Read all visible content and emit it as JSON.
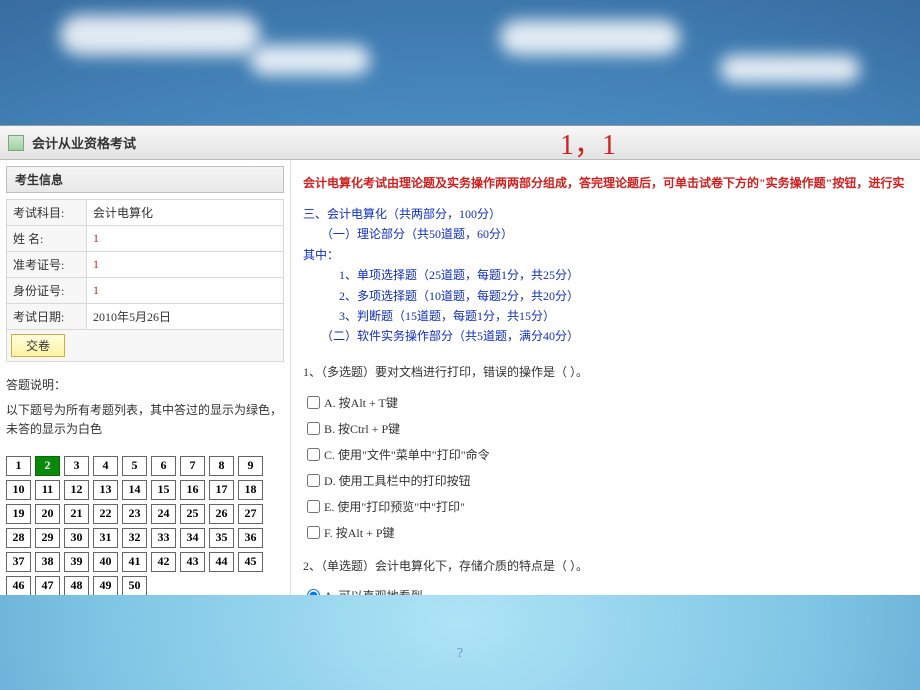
{
  "titlebar": {
    "title": "会计从业资格考试",
    "red_marker": "1，1"
  },
  "left": {
    "panel_title": "考生信息",
    "rows": {
      "subject_label": "考试科目:",
      "subject_value": "会计电算化",
      "name_label": "姓 名:",
      "name_value": "1",
      "admission_label": "准考证号:",
      "admission_value": "1",
      "id_label": "身份证号:",
      "id_value": "1",
      "date_label": "考试日期:",
      "date_value": "2010年5月26日"
    },
    "submit_label": "交卷",
    "desc_title": "答题说明：",
    "desc_body": "以下题号为所有考题列表，其中答过的显示为绿色，未答的显示为白色",
    "total_questions": 50,
    "answered": [
      2
    ]
  },
  "right": {
    "notice": "会计电算化考试由理论题及实务操作两两部分组成，答完理论题后，可单击试卷下方的\"实务操作题\"按钮，进行实",
    "structure": {
      "l1": "三、会计电算化（共两部分，100分）",
      "l2": "（一）理论部分（共50道题，60分）",
      "l3": "其中：",
      "l4": "1、单项选择题（25道题，每题1分，共25分）",
      "l5": "2、多项选择题（10道题，每题2分，共20分）",
      "l6": "3、判断题（15道题，每题1分，共15分）",
      "l7": "（二）软件实务操作部分（共5道题，满分40分）"
    },
    "q1": {
      "stem": "1、（多选题）要对文档进行打印，错误的操作是（ ）。",
      "options": {
        "a": "A. 按Alt + T键",
        "b": "B. 按Ctrl + P键",
        "c": "C. 使用\"文件\"菜单中\"打印\"命令",
        "d": "D. 使用工具栏中的打印按钮",
        "e": "E. 使用\"打印预览\"中\"打印\"",
        "f": "F. 按Alt + P键"
      }
    },
    "q2": {
      "stem": "2、（单选题）会计电算化下，存储介质的特点是（ ）。",
      "options": {
        "a": "A. 可以直观地看到"
      },
      "selected": "a"
    }
  },
  "footer_glyph": "?"
}
